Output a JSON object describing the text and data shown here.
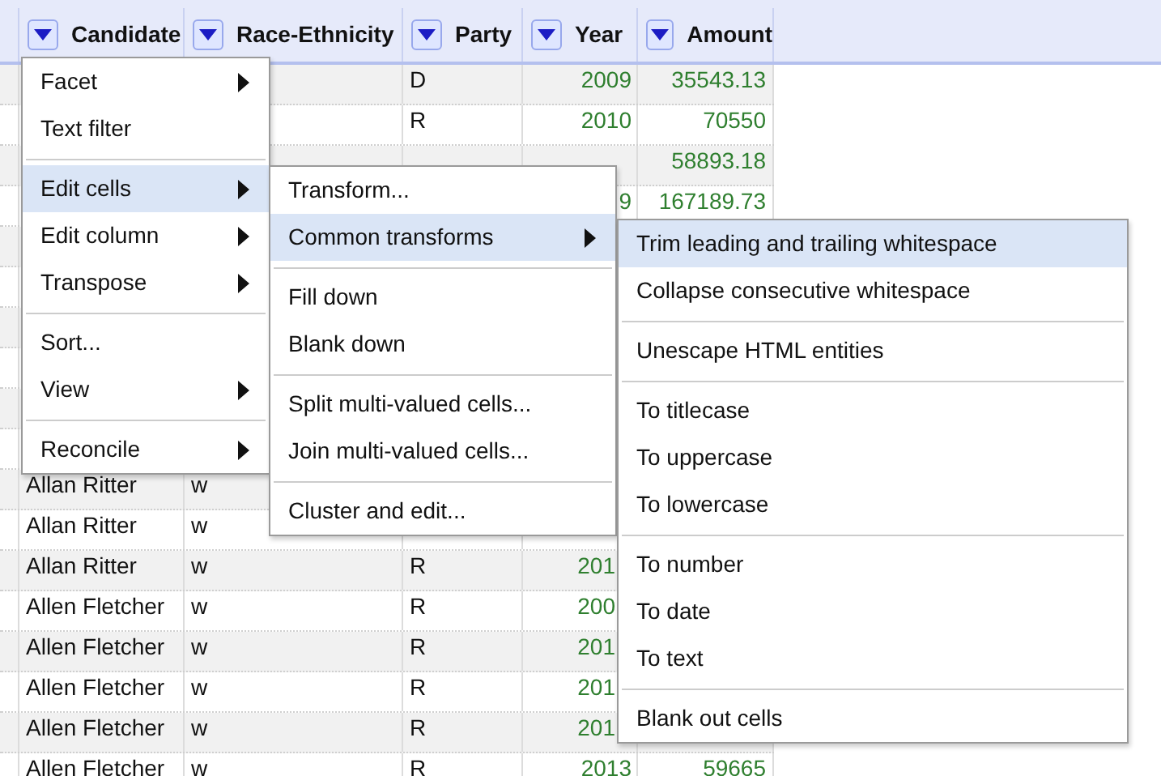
{
  "table": {
    "columns": [
      {
        "label": "Candidate"
      },
      {
        "label": "Race-Ethnicity"
      },
      {
        "label": "Party"
      },
      {
        "label": "Year"
      },
      {
        "label": "Amount"
      }
    ],
    "rows": [
      {
        "party": "D",
        "year": "2009",
        "year_clipped": false,
        "amount": "35543.13"
      },
      {
        "party": "R",
        "year": "2010",
        "year_clipped": false,
        "amount": "70550"
      },
      {
        "amount": "58893.18"
      },
      {
        "year": "9",
        "year_clipped": false,
        "amount": "167189.73"
      },
      {},
      {},
      {},
      {},
      {},
      {},
      {
        "candidate": "Allan Ritter",
        "race": "w"
      },
      {
        "candidate": "Allan Ritter",
        "race": "w"
      },
      {
        "candidate": "Allan Ritter",
        "race": "w",
        "party": "R",
        "year": "201",
        "year_clipped": true
      },
      {
        "candidate": "Allen Fletcher",
        "race": "w",
        "party": "R",
        "year": "200",
        "year_clipped": true
      },
      {
        "candidate": "Allen Fletcher",
        "race": "w",
        "party": "R",
        "year": "201",
        "year_clipped": true
      },
      {
        "candidate": "Allen Fletcher",
        "race": "w",
        "party": "R",
        "year": "201",
        "year_clipped": true
      },
      {
        "candidate": "Allen Fletcher",
        "race": "w",
        "party": "R",
        "year": "201",
        "year_clipped": true
      },
      {
        "candidate": "Allen Fletcher",
        "race": "w",
        "party": "R",
        "year": "2013",
        "year_clipped": false,
        "amount": "59665"
      }
    ]
  },
  "menus": [
    {
      "items": [
        {
          "kind": "item",
          "label": "Facet",
          "submenu": true,
          "selected": false
        },
        {
          "kind": "item",
          "label": "Text filter",
          "submenu": false,
          "selected": false
        },
        {
          "kind": "divider"
        },
        {
          "kind": "item",
          "label": "Edit cells",
          "submenu": true,
          "selected": true
        },
        {
          "kind": "item",
          "label": "Edit column",
          "submenu": true,
          "selected": false
        },
        {
          "kind": "item",
          "label": "Transpose",
          "submenu": true,
          "selected": false
        },
        {
          "kind": "divider"
        },
        {
          "kind": "item",
          "label": "Sort...",
          "submenu": false,
          "selected": false
        },
        {
          "kind": "item",
          "label": "View",
          "submenu": true,
          "selected": false
        },
        {
          "kind": "divider"
        },
        {
          "kind": "item",
          "label": "Reconcile",
          "submenu": true,
          "selected": false
        }
      ]
    },
    {
      "items": [
        {
          "kind": "item",
          "label": "Transform...",
          "submenu": false,
          "selected": false
        },
        {
          "kind": "item",
          "label": "Common transforms",
          "submenu": true,
          "selected": true
        },
        {
          "kind": "divider"
        },
        {
          "kind": "item",
          "label": "Fill down",
          "submenu": false,
          "selected": false
        },
        {
          "kind": "item",
          "label": "Blank down",
          "submenu": false,
          "selected": false
        },
        {
          "kind": "divider"
        },
        {
          "kind": "item",
          "label": "Split multi-valued cells...",
          "submenu": false,
          "selected": false
        },
        {
          "kind": "item",
          "label": "Join multi-valued cells...",
          "submenu": false,
          "selected": false
        },
        {
          "kind": "divider"
        },
        {
          "kind": "item",
          "label": "Cluster and edit...",
          "submenu": false,
          "selected": false
        }
      ]
    },
    {
      "items": [
        {
          "kind": "item",
          "label": "Trim leading and trailing whitespace",
          "submenu": false,
          "selected": true
        },
        {
          "kind": "item",
          "label": "Collapse consecutive whitespace",
          "submenu": false,
          "selected": false
        },
        {
          "kind": "divider"
        },
        {
          "kind": "item",
          "label": "Unescape HTML entities",
          "submenu": false,
          "selected": false
        },
        {
          "kind": "divider"
        },
        {
          "kind": "item",
          "label": "To titlecase",
          "submenu": false,
          "selected": false
        },
        {
          "kind": "item",
          "label": "To uppercase",
          "submenu": false,
          "selected": false
        },
        {
          "kind": "item",
          "label": "To lowercase",
          "submenu": false,
          "selected": false
        },
        {
          "kind": "divider"
        },
        {
          "kind": "item",
          "label": "To number",
          "submenu": false,
          "selected": false
        },
        {
          "kind": "item",
          "label": "To date",
          "submenu": false,
          "selected": false
        },
        {
          "kind": "item",
          "label": "To text",
          "submenu": false,
          "selected": false
        },
        {
          "kind": "divider"
        },
        {
          "kind": "item",
          "label": "Blank out cells",
          "submenu": false,
          "selected": false
        }
      ]
    }
  ]
}
